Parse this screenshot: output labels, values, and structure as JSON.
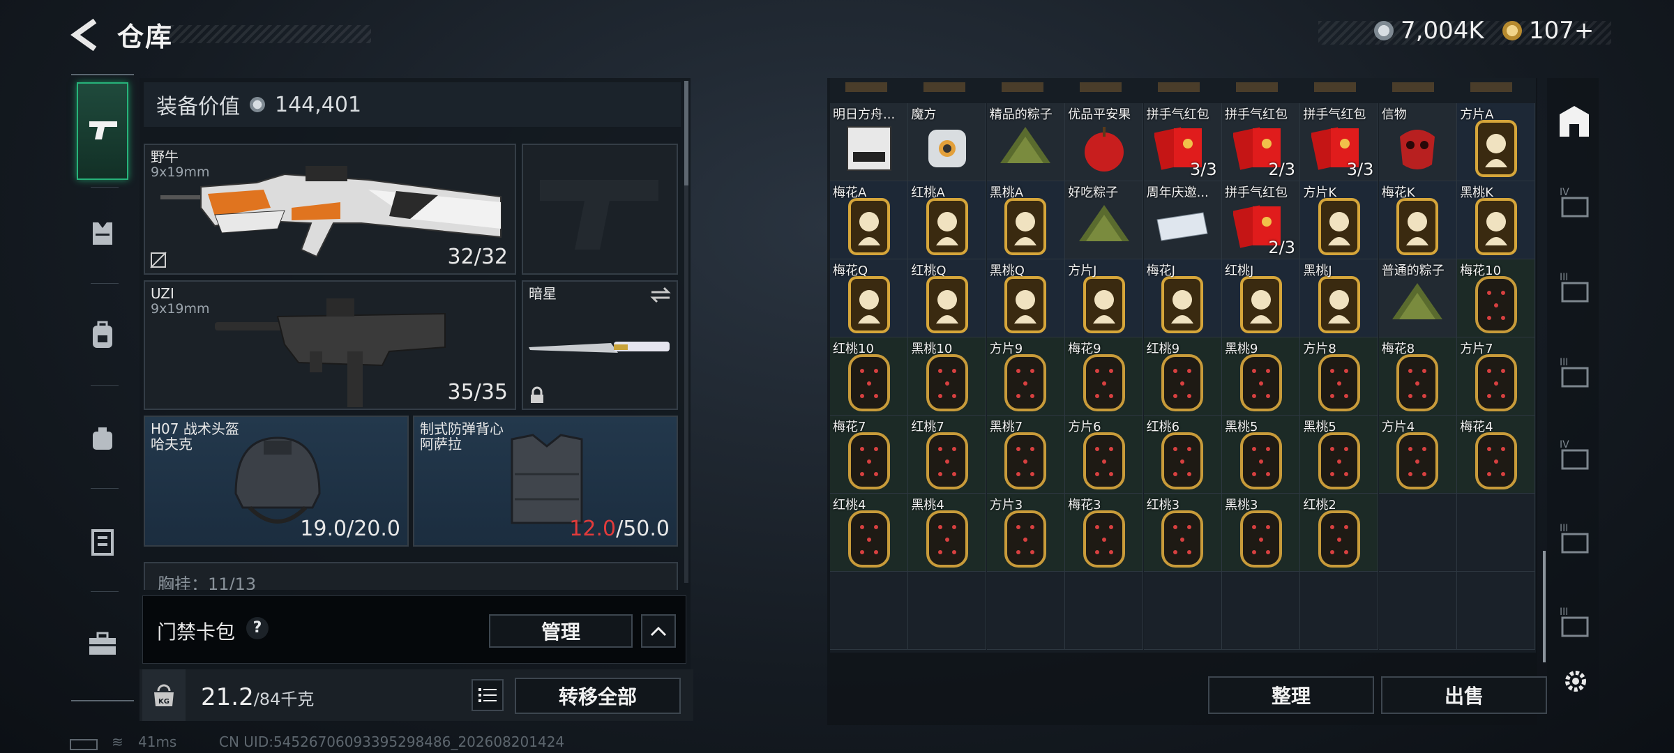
{
  "header": {
    "title": "仓库",
    "currency1": "7,004K",
    "currency2": "107+"
  },
  "equipment": {
    "value_label": "装备价值",
    "value": "144,401",
    "primary": {
      "name": "野牛",
      "caliber": "9x19mm",
      "ammo": "32/32"
    },
    "secondary": {
      "name": "UZI",
      "caliber": "9x19mm",
      "ammo": "35/35"
    },
    "melee": {
      "name": "暗星"
    },
    "helmet": {
      "name": "H07 战术头盔",
      "maker": "哈夫克",
      "durability_current": "19.0",
      "durability_max": "/20.0"
    },
    "vest": {
      "name": "制式防弹背心",
      "maker": "阿萨拉",
      "durability_current": "12.0",
      "durability_max": "/50.0"
    },
    "chest_partial": "胸挂：11/13",
    "colors": {
      "accent": "#27b37a",
      "low_durability": "#e23b3b"
    }
  },
  "card_pack": {
    "label": "门禁卡包",
    "help": "?",
    "manage": "管理"
  },
  "footer": {
    "weight_current": "21.2",
    "weight_max": "/84千克",
    "transfer_all": "转移全部",
    "organize": "整理",
    "sell": "出售"
  },
  "status": {
    "ping": "41ms",
    "uid": "CN UID:54526706093395298486_202608201424"
  },
  "items": [
    {
      "name": "明日方舟...",
      "count": "",
      "kind": "disc"
    },
    {
      "name": "魔方",
      "count": "",
      "kind": "cube"
    },
    {
      "name": "精品的粽子",
      "count": "",
      "kind": "zongzi"
    },
    {
      "name": "优品平安果",
      "count": "",
      "kind": "apple"
    },
    {
      "name": "拼手气红包",
      "count": "3/3",
      "kind": "redpacket"
    },
    {
      "name": "拼手气红包",
      "count": "2/3",
      "kind": "redpacket"
    },
    {
      "name": "拼手气红包",
      "count": "3/3",
      "kind": "redpacket"
    },
    {
      "name": "信物",
      "count": "",
      "kind": "mask"
    },
    {
      "name": "方片A",
      "count": "",
      "kind": "face"
    },
    {
      "name": "梅花A",
      "count": "",
      "kind": "face"
    },
    {
      "name": "红桃A",
      "count": "",
      "kind": "face"
    },
    {
      "name": "黑桃A",
      "count": "",
      "kind": "face"
    },
    {
      "name": "好吃粽子",
      "count": "",
      "kind": "zongzi"
    },
    {
      "name": "周年庆邀...",
      "count": "",
      "kind": "letter"
    },
    {
      "name": "拼手气红包",
      "count": "2/3",
      "kind": "redpacket"
    },
    {
      "name": "方片K",
      "count": "",
      "kind": "face"
    },
    {
      "name": "梅花K",
      "count": "",
      "kind": "face"
    },
    {
      "name": "黑桃K",
      "count": "",
      "kind": "face"
    },
    {
      "name": "梅花Q",
      "count": "",
      "kind": "face"
    },
    {
      "name": "红桃Q",
      "count": "",
      "kind": "face"
    },
    {
      "name": "黑桃Q",
      "count": "",
      "kind": "face"
    },
    {
      "name": "方片J",
      "count": "",
      "kind": "face"
    },
    {
      "name": "梅花J",
      "count": "",
      "kind": "face"
    },
    {
      "name": "红桃J",
      "count": "",
      "kind": "face"
    },
    {
      "name": "黑桃J",
      "count": "",
      "kind": "face"
    },
    {
      "name": "普通的粽子",
      "count": "",
      "kind": "zongzi"
    },
    {
      "name": "梅花10",
      "count": "",
      "kind": "pip"
    },
    {
      "name": "红桃10",
      "count": "",
      "kind": "pip"
    },
    {
      "name": "黑桃10",
      "count": "",
      "kind": "pip"
    },
    {
      "name": "方片9",
      "count": "",
      "kind": "pip"
    },
    {
      "name": "梅花9",
      "count": "",
      "kind": "pip"
    },
    {
      "name": "红桃9",
      "count": "",
      "kind": "pip"
    },
    {
      "name": "黑桃9",
      "count": "",
      "kind": "pip"
    },
    {
      "name": "方片8",
      "count": "",
      "kind": "pip"
    },
    {
      "name": "梅花8",
      "count": "",
      "kind": "pip"
    },
    {
      "name": "方片7",
      "count": "",
      "kind": "pip"
    },
    {
      "name": "梅花7",
      "count": "",
      "kind": "pip"
    },
    {
      "name": "红桃7",
      "count": "",
      "kind": "pip"
    },
    {
      "name": "黑桃7",
      "count": "",
      "kind": "pip"
    },
    {
      "name": "方片6",
      "count": "",
      "kind": "pip"
    },
    {
      "name": "红桃6",
      "count": "",
      "kind": "pip"
    },
    {
      "name": "黑桃5",
      "count": "",
      "kind": "pip"
    },
    {
      "name": "黑桃5",
      "count": "",
      "kind": "pip"
    },
    {
      "name": "方片4",
      "count": "",
      "kind": "pip"
    },
    {
      "name": "梅花4",
      "count": "",
      "kind": "pip"
    },
    {
      "name": "红桃4",
      "count": "",
      "kind": "pip"
    },
    {
      "name": "黑桃4",
      "count": "",
      "kind": "pip"
    },
    {
      "name": "方片3",
      "count": "",
      "kind": "pip"
    },
    {
      "name": "梅花3",
      "count": "",
      "kind": "pip"
    },
    {
      "name": "红桃3",
      "count": "",
      "kind": "pip"
    },
    {
      "name": "黑桃3",
      "count": "",
      "kind": "pip"
    },
    {
      "name": "红桃2",
      "count": "",
      "kind": "pip"
    }
  ]
}
